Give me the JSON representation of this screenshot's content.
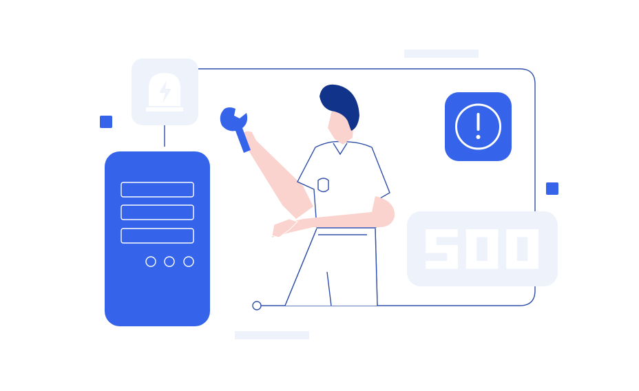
{
  "illustration": {
    "error_code": "500",
    "colors": {
      "primary_blue": "#3563E9",
      "light_panel": "#EEF2FB",
      "outline": "#2D4DA8",
      "hair": "#12338A",
      "skin": "#FAD3CF",
      "white": "#FFFFFF"
    },
    "icons": [
      "alarm-light-icon",
      "warning-icon",
      "wrench-icon",
      "server-icon"
    ]
  }
}
